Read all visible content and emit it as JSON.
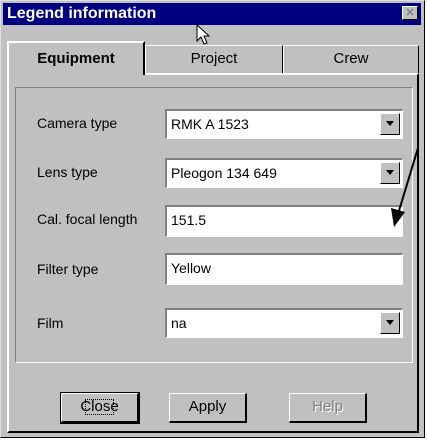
{
  "window": {
    "title": "Legend information",
    "close_glyph": "✕"
  },
  "tabs": [
    {
      "label": "Equipment",
      "active": true
    },
    {
      "label": "Project",
      "active": false
    },
    {
      "label": "Crew",
      "active": false
    }
  ],
  "fields": {
    "camera_type": {
      "label": "Camera type",
      "value": "RMK A 1523"
    },
    "lens_type": {
      "label": "Lens type",
      "value": "Pleogon 134 649"
    },
    "focal_length": {
      "label": "Cal. focal length",
      "value": "151.5"
    },
    "filter_type": {
      "label": "Filter type",
      "value": "Yellow"
    },
    "film": {
      "label": "Film",
      "value": "na"
    }
  },
  "buttons": {
    "close": "Close",
    "apply": "Apply",
    "help": "Help"
  },
  "colors": {
    "titlebar": "#000080",
    "face": "#c0c0c0"
  }
}
